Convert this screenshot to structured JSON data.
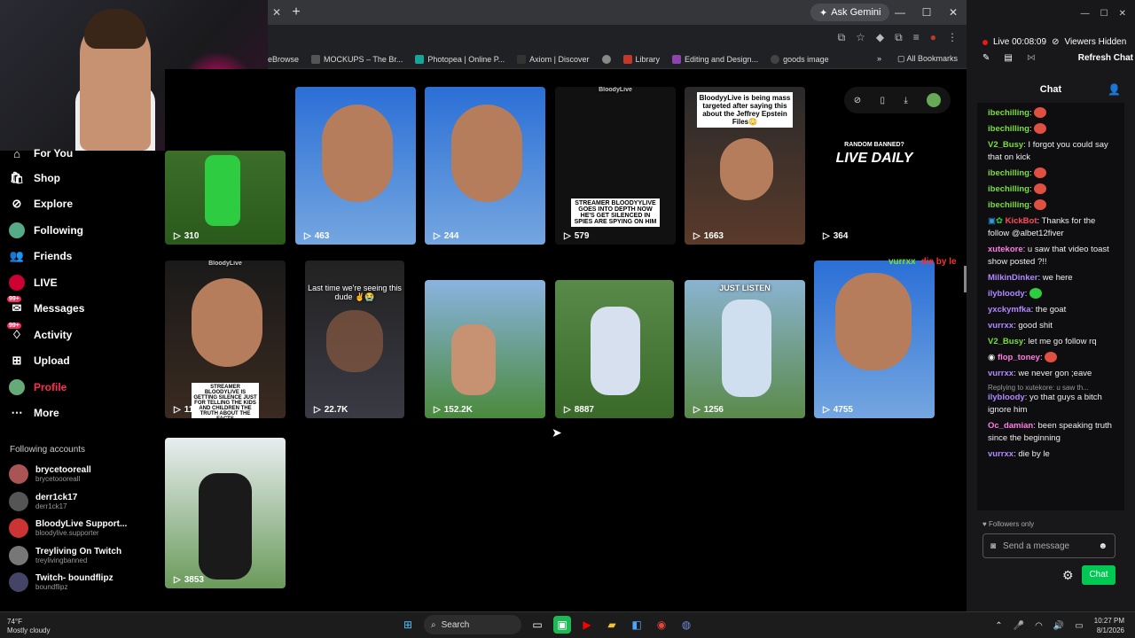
{
  "browser": {
    "gemini_label": "Ask Gemini",
    "bookmarks": [
      {
        "label": "eBrowse",
        "color": "#202124"
      },
      {
        "label": "MOCKUPS – The Br...",
        "color": "#555"
      },
      {
        "label": "Photopea | Online P...",
        "color": "#18a497"
      },
      {
        "label": "Axiom | Discover",
        "color": "#333"
      },
      {
        "label": "",
        "color": "#888"
      },
      {
        "label": "Library",
        "color": "#c0392b"
      },
      {
        "label": "Editing and Design...",
        "color": "#8e44ad"
      },
      {
        "label": "goods image",
        "color": "#444"
      }
    ],
    "all_bookmarks": "All Bookmarks"
  },
  "sidebar": {
    "nav": [
      {
        "label": "For You",
        "icon": "home-icon"
      },
      {
        "label": "Shop",
        "icon": "shop-icon"
      },
      {
        "label": "Explore",
        "icon": "compass-icon"
      },
      {
        "label": "Following",
        "icon": "following-icon"
      },
      {
        "label": "Friends",
        "icon": "friends-icon"
      },
      {
        "label": "LIVE",
        "icon": "live-icon"
      },
      {
        "label": "Messages",
        "icon": "messages-icon",
        "badge": "99+"
      },
      {
        "label": "Activity",
        "icon": "activity-icon",
        "badge": "99+"
      },
      {
        "label": "Upload",
        "icon": "upload-icon"
      },
      {
        "label": "Profile",
        "icon": "profile-icon"
      },
      {
        "label": "More",
        "icon": "more-icon"
      }
    ],
    "following_title": "Following accounts",
    "following": [
      {
        "name": "brycetooreall",
        "user": "brycetoooreall"
      },
      {
        "name": "derr1ck17",
        "user": "derr1ck17"
      },
      {
        "name": "BloodyLive Support...",
        "user": "bloodylive.supporter"
      },
      {
        "name": "Treyliving On Twitch",
        "user": "treylivingbanned"
      },
      {
        "name": "Twitch- boundflipz",
        "user": "boundflipz"
      }
    ]
  },
  "videos": [
    {
      "views": "310"
    },
    {
      "views": "463"
    },
    {
      "views": "244"
    },
    {
      "views": "579",
      "caption": "STREAMER BLOODYYLIVE GOES INTO DEPTH NOW HE'S GET SILENCED IN SPIES ARE SPYING ON HIM",
      "top_label": "BloodyLive"
    },
    {
      "views": "1663",
      "caption": "BloodyyLive is being mass targeted after saying this about the Jeffrey Epstein Files😳"
    },
    {
      "views": "364",
      "caption": "LIVE DAILY",
      "sub_caption": "RANDOM BANNED?"
    },
    {
      "views": "11",
      "caption": "STREAMER BLOODYLIVE IS GETTING SILENCE JUST FOR TELLING THE KIDS AND CHILDREN THE TRUTH ABOUT THE FACTS",
      "top_label": "BloodyLive"
    },
    {
      "views": "22.7K",
      "caption": "Last time we're seeing this dude ✌️😭"
    },
    {
      "views": "152.2K"
    },
    {
      "views": "8887"
    },
    {
      "views": "1256",
      "caption": "JUST LISTEN"
    },
    {
      "views": "4755"
    },
    {
      "views": "3853"
    }
  ],
  "float_toolbar": [
    "⊘",
    "▯",
    "⤓"
  ],
  "overlay": {
    "user": "vurrxx",
    "text": "die by le"
  },
  "chat": {
    "live_time": "Live 00:08:09",
    "viewers": "Viewers Hidden",
    "refresh": "Refresh Chat",
    "title": "Chat",
    "messages": [
      {
        "user": "ibechilling",
        "color": "#7cdd3b",
        "text": "",
        "emote": true
      },
      {
        "user": "ibechilling",
        "color": "#7cdd3b",
        "text": "",
        "emote": true
      },
      {
        "user": "V2_Busy",
        "color": "#7cdd3b",
        "text": "I forgot you could say that on kick"
      },
      {
        "user": "ibechilling",
        "color": "#7cdd3b",
        "text": "",
        "emote": true
      },
      {
        "user": "ibechilling",
        "color": "#7cdd3b",
        "text": "",
        "emote": true
      },
      {
        "user": "ibechilling",
        "color": "#7cdd3b",
        "text": "",
        "emote": true
      },
      {
        "user": "KickBot",
        "color": "#ff4b5c",
        "text": "Thanks for the follow @albet12fiver"
      },
      {
        "user": "xutekore",
        "color": "#ff7ee3",
        "text": "u saw that video toast show posted ?!!"
      },
      {
        "user": "MilkinDinker",
        "color": "#b089ff",
        "text": "we here"
      },
      {
        "user": "ilybloody",
        "color": "#b089ff",
        "text": "",
        "emote": true
      },
      {
        "user": "yxckymfka",
        "color": "#b089ff",
        "text": "the goat"
      },
      {
        "user": "vurrxx",
        "color": "#b089ff",
        "text": "good shit"
      },
      {
        "user": "V2_Busy",
        "color": "#7cdd3b",
        "text": "let me go follow rq"
      },
      {
        "user": "flop_toney",
        "color": "#ff7ee3",
        "text": "",
        "emote": true
      },
      {
        "user": "vurrxx",
        "color": "#b089ff",
        "text": "we never gon ;eave"
      },
      {
        "user": "ilybloody",
        "color": "#b089ff",
        "text": "yo that guys a bitch ignore him",
        "reply": "Replying to xutekore: u saw th..."
      },
      {
        "user": "Oc_damian",
        "color": "#ff7ee3",
        "text": "been speaking truth since the beginning"
      },
      {
        "user": "vurrxx",
        "color": "#b089ff",
        "text": "die by le"
      }
    ],
    "followers_only": "Followers only",
    "placeholder": "Send a message",
    "send": "Chat"
  },
  "taskbar": {
    "weather_temp": "74°F",
    "weather_desc": "Mostly cloudy",
    "search": "Search",
    "time": "10:27 PM",
    "date": "8/1/2026"
  }
}
